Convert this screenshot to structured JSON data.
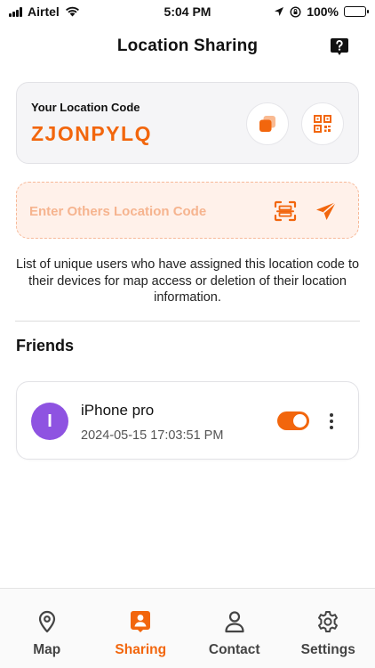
{
  "status_bar": {
    "carrier": "Airtel",
    "time": "5:04 PM",
    "battery": "100%"
  },
  "header": {
    "title": "Location Sharing"
  },
  "location_code": {
    "label": "Your Location Code",
    "value": "ZJONPYLQ"
  },
  "enter_code": {
    "placeholder": "Enter Others Location Code",
    "value": ""
  },
  "info_text": "List of unique users who have assigned this location code to their devices for map access or deletion of their location information.",
  "friends": {
    "title": "Friends",
    "items": [
      {
        "initial": "I",
        "name": "iPhone pro",
        "timestamp": "2024-05-15 17:03:51 PM",
        "sharing_enabled": true
      }
    ]
  },
  "bottom_nav": {
    "items": [
      {
        "label": "Map",
        "icon": "map-pin-icon"
      },
      {
        "label": "Sharing",
        "icon": "person-badge-icon",
        "active": true
      },
      {
        "label": "Contact",
        "icon": "person-icon"
      },
      {
        "label": "Settings",
        "icon": "gear-icon"
      }
    ]
  },
  "colors": {
    "accent": "#f2660d",
    "avatar": "#8e53e1",
    "battery": "#36c241"
  }
}
